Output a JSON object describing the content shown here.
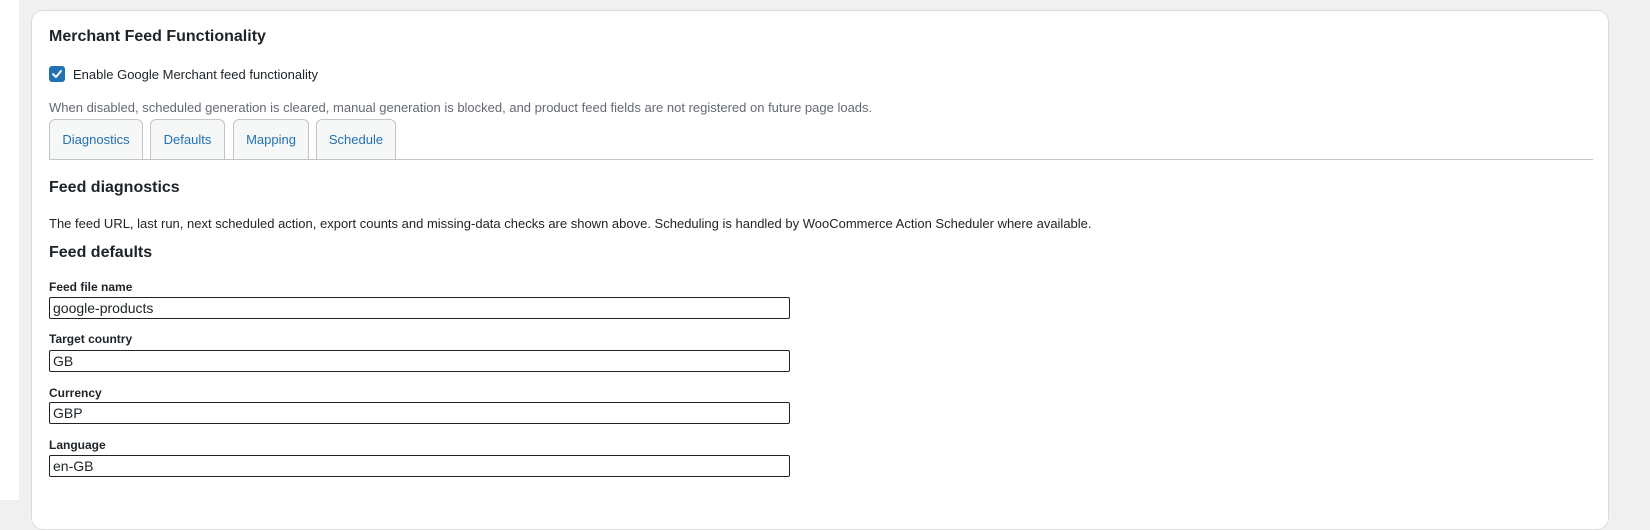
{
  "panel": {
    "title": "Merchant Feed Functionality",
    "enable_label": "Enable Google Merchant feed functionality",
    "enable_checked": true,
    "note": "When disabled, scheduled generation is cleared, manual generation is blocked, and product feed fields are not registered on future page loads."
  },
  "tabs": [
    {
      "label": "Diagnostics"
    },
    {
      "label": "Defaults"
    },
    {
      "label": "Mapping"
    },
    {
      "label": "Schedule"
    }
  ],
  "diagnostics": {
    "heading": "Feed diagnostics",
    "description": "The feed URL, last run, next scheduled action, export counts and missing-data checks are shown above. Scheduling is handled by WooCommerce Action Scheduler where available."
  },
  "defaults": {
    "heading": "Feed defaults",
    "fields": [
      {
        "label": "Feed file name",
        "value": "google-products"
      },
      {
        "label": "Target country",
        "value": "GB"
      },
      {
        "label": "Currency",
        "value": "GBP"
      },
      {
        "label": "Language",
        "value": "en-GB"
      }
    ]
  },
  "colors": {
    "accent": "#2271b1",
    "page_bg": "#f0f0f1",
    "muted_text": "#646970"
  }
}
